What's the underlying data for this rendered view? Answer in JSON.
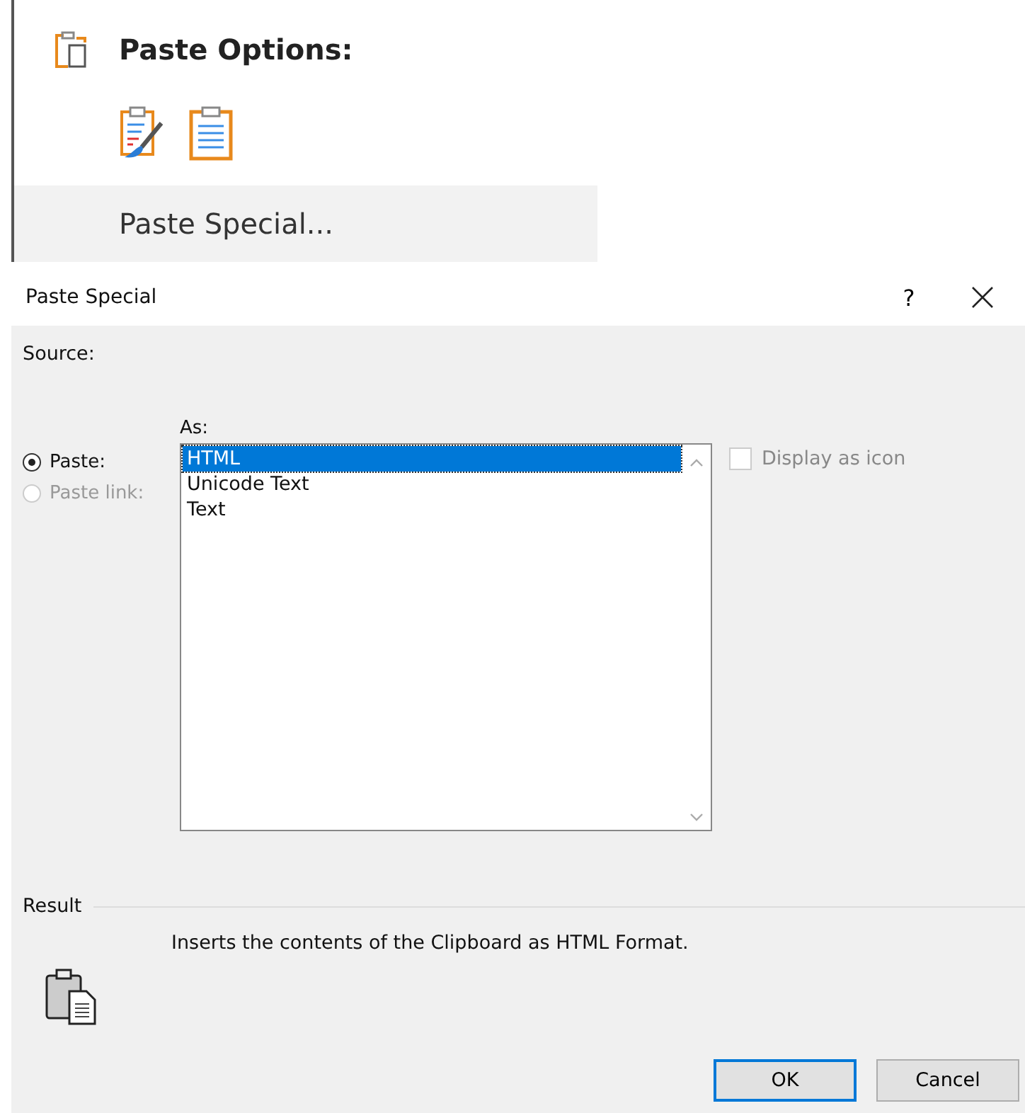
{
  "context_menu": {
    "header": "Paste Options:",
    "paste_options": [
      {
        "kind": "keep-formatting"
      },
      {
        "kind": "text-only"
      }
    ],
    "item": {
      "label": "Paste Special...",
      "selected": true
    }
  },
  "dialog": {
    "title": "Paste Special",
    "help": "?",
    "source_label": "Source:",
    "as_label": "As:",
    "modes": [
      {
        "label": "Paste:",
        "selected": true,
        "disabled": false
      },
      {
        "label": "Paste link:",
        "selected": false,
        "disabled": true
      }
    ],
    "formats": [
      {
        "label": "HTML",
        "selected": true
      },
      {
        "label": "Unicode Text",
        "selected": false
      },
      {
        "label": "Text",
        "selected": false
      }
    ],
    "display_as_icon": {
      "label": "Display as icon",
      "checked": false,
      "disabled": true
    },
    "result_label": "Result",
    "result_text": "Inserts the contents of the Clipboard as HTML Format.",
    "buttons": [
      {
        "label": "OK",
        "default": true
      },
      {
        "label": "Cancel",
        "default": false
      }
    ]
  }
}
